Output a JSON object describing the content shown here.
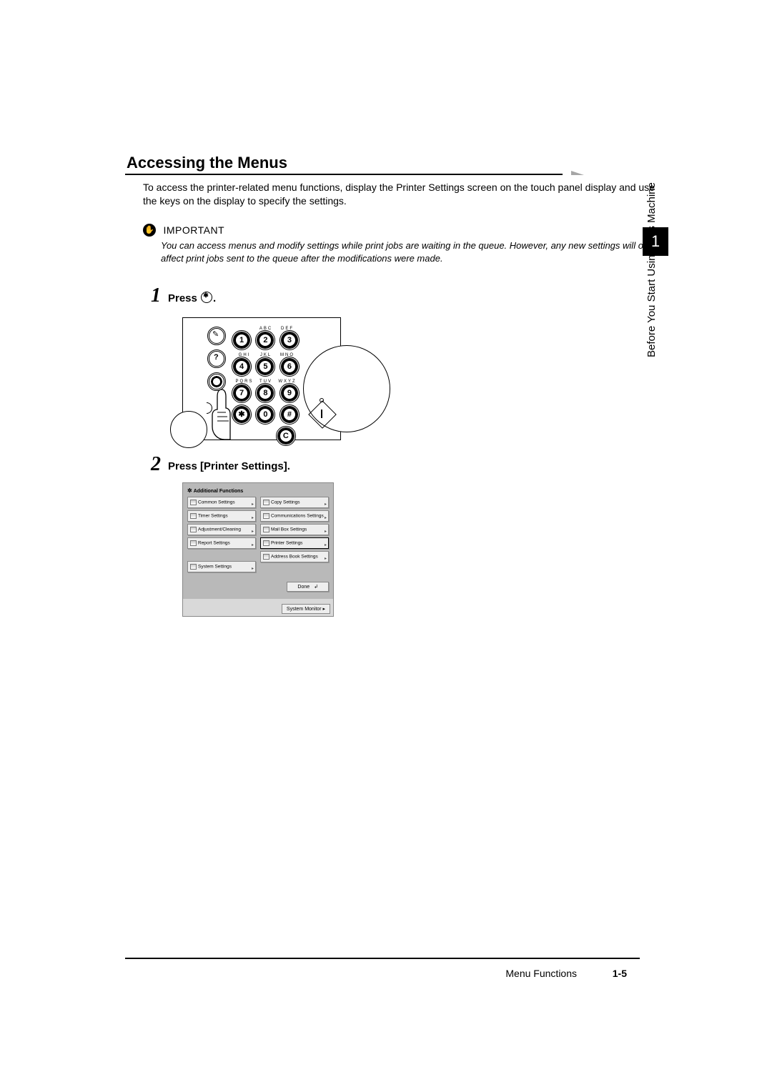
{
  "heading": "Accessing the Menus",
  "intro": "To access the printer-related menu functions, display the Printer Settings screen on the touch panel display and use the keys on the display to specify the settings.",
  "important": {
    "label": "IMPORTANT",
    "icon_glyph": "✋",
    "text": "You can access menus and modify settings while print jobs are waiting in the queue. However, any new settings will only affect print jobs sent to the queue after the modifications were made."
  },
  "steps": [
    {
      "num": "1",
      "title_prefix": "Press ",
      "title_suffix": "."
    },
    {
      "num": "2",
      "title": "Press [Printer Settings]."
    }
  ],
  "keypad": {
    "row_labels": [
      [
        "",
        "ABC",
        "DEF"
      ],
      [
        "GHI",
        "JKL",
        "MNO"
      ],
      [
        "PQRS",
        "TUV",
        "WXYZ"
      ]
    ],
    "rows": [
      [
        "1",
        "2",
        "3"
      ],
      [
        "4",
        "5",
        "6"
      ],
      [
        "7",
        "8",
        "9"
      ],
      [
        "✱",
        "0",
        "#"
      ]
    ],
    "clear": "C",
    "aux": {
      "pencil": "✎",
      "help": "?"
    }
  },
  "screenshot": {
    "header": "Additional Functions",
    "left": [
      "Common Settings",
      "Timer Settings",
      "Adjustment/Cleaning",
      "Report Settings"
    ],
    "left_lower": [
      "System Settings"
    ],
    "right": [
      "Copy Settings",
      "Communications Settings",
      "Mail Box Settings",
      "Printer Settings",
      "Address Book Settings"
    ],
    "done": "Done",
    "sysmon": "System Monitor"
  },
  "side": {
    "chapter": "1",
    "label": "Before You Start Using This Machine"
  },
  "footer": {
    "title": "Menu Functions",
    "page": "1-5"
  }
}
